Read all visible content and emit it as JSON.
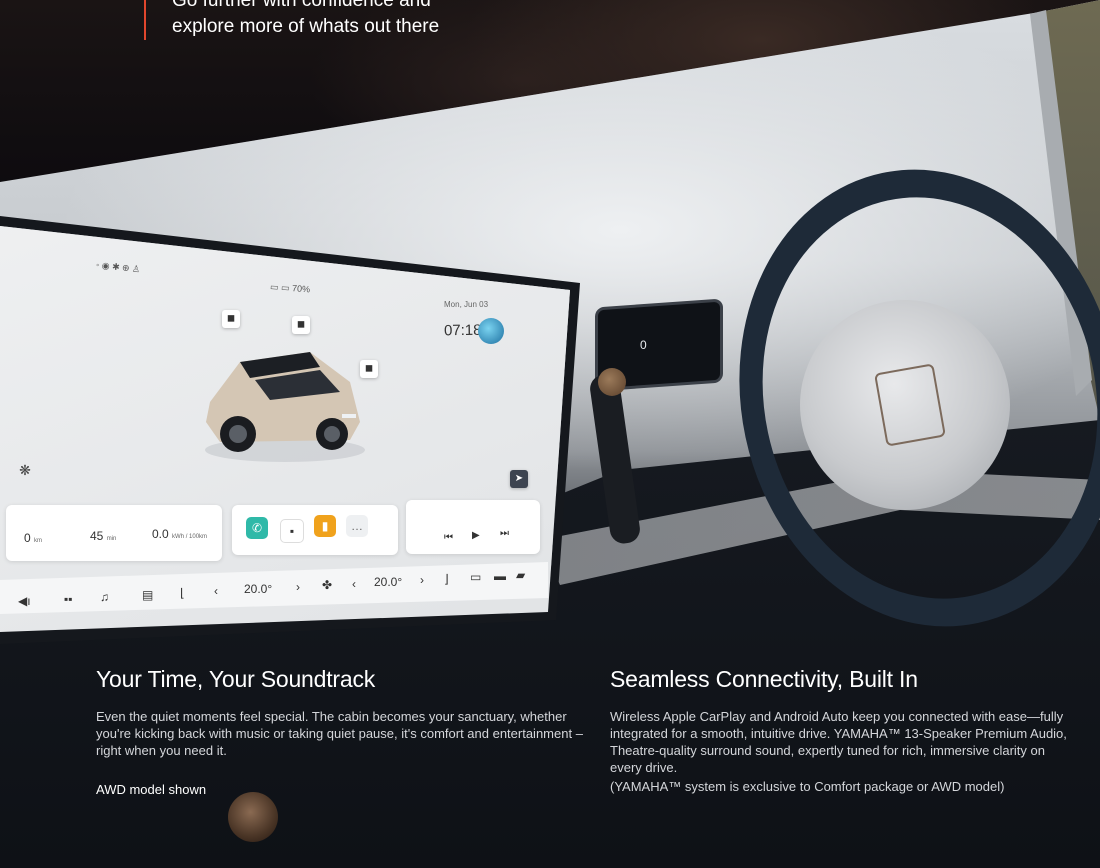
{
  "hero": {
    "tagline_line1": "Go further with confidence and",
    "tagline_line2": "explore more of whats out there"
  },
  "screen": {
    "clock": "07:18",
    "date": "Mon, Jun 03",
    "status_battery": "70%",
    "stats": [
      {
        "value": "0",
        "unit": "km"
      },
      {
        "value": "45",
        "unit": "min"
      },
      {
        "value": "0.0",
        "unit": "kWh / 100km"
      }
    ],
    "nav": {
      "temp_left": "20.0°",
      "temp_right": "20.0°"
    },
    "pod_value": "0"
  },
  "sections": [
    {
      "heading": "Your Time, Your Soundtrack",
      "body": "Even the quiet moments feel special. The cabin becomes your sanctuary, whether you're kicking back with music or taking quiet pause, it's comfort and entertainment – right when you need it.",
      "note": "AWD model shown"
    },
    {
      "heading": "Seamless Connectivity, Built In",
      "body": "Wireless Apple CarPlay and Android Auto keep you connected with ease—fully integrated for a smooth, intuitive drive. YAMAHA™ 13-Speaker Premium Audio, Theatre-quality surround sound, expertly tuned for rich, immersive clarity on every drive.",
      "note": "(YAMAHA™ system is exclusive to Comfort package or AWD model)"
    }
  ],
  "colors": {
    "accent": "#e1462d",
    "background": "#0d0b0f"
  }
}
